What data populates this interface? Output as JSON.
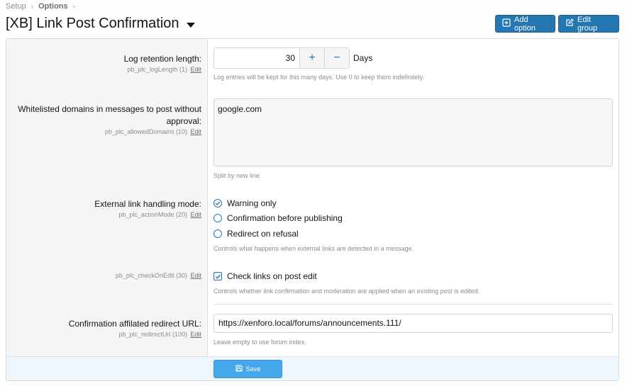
{
  "breadcrumb": {
    "items": [
      "Setup",
      "Options"
    ]
  },
  "header": {
    "title": "[XB] Link Post Confirmation",
    "add_option_label": "Add option",
    "edit_group_label": "Edit group"
  },
  "options": {
    "log_length": {
      "label": "Log retention length:",
      "meta": "pb_plc_logLength (1)",
      "edit": "Edit",
      "value": "30",
      "plus": "+",
      "minus": "−",
      "units": "Days",
      "hint": "Log entries will be kept for this many days. Use 0 to keep them indefinitely."
    },
    "allowed_domains": {
      "label": "Whitelisted domains in messages to post without approval:",
      "meta": "pb_plc_allowedDomains (10)",
      "edit": "Edit",
      "value": "google.com",
      "hint": "Split by new line"
    },
    "action_mode": {
      "label": "External link handling mode:",
      "meta": "pb_plc_actionMode (20)",
      "edit": "Edit",
      "choices": [
        "Warning only",
        "Confirmation before publishing",
        "Redirect on refusal"
      ],
      "selected": "Warning only",
      "hint": "Controls what happens when external links are detected in a message."
    },
    "check_on_edit": {
      "meta": "pb_plc_checkOnEdit (30)",
      "edit": "Edit",
      "label": "Check links on post edit",
      "checked": true,
      "hint": "Controls whether link confirmation and moderation are applied when an existing post is edited."
    },
    "redirect_url": {
      "label": "Confirmation affilated redirect URL:",
      "meta": "pb_plc_redirectUrl (100)",
      "edit": "Edit",
      "value": "https://xenforo.local/forums/announcements.111/",
      "hint": "Leave empty to use forum index."
    }
  },
  "footer": {
    "save_label": "Save"
  },
  "colors": {
    "accent": "#2577b1",
    "save": "#47a7eb"
  }
}
